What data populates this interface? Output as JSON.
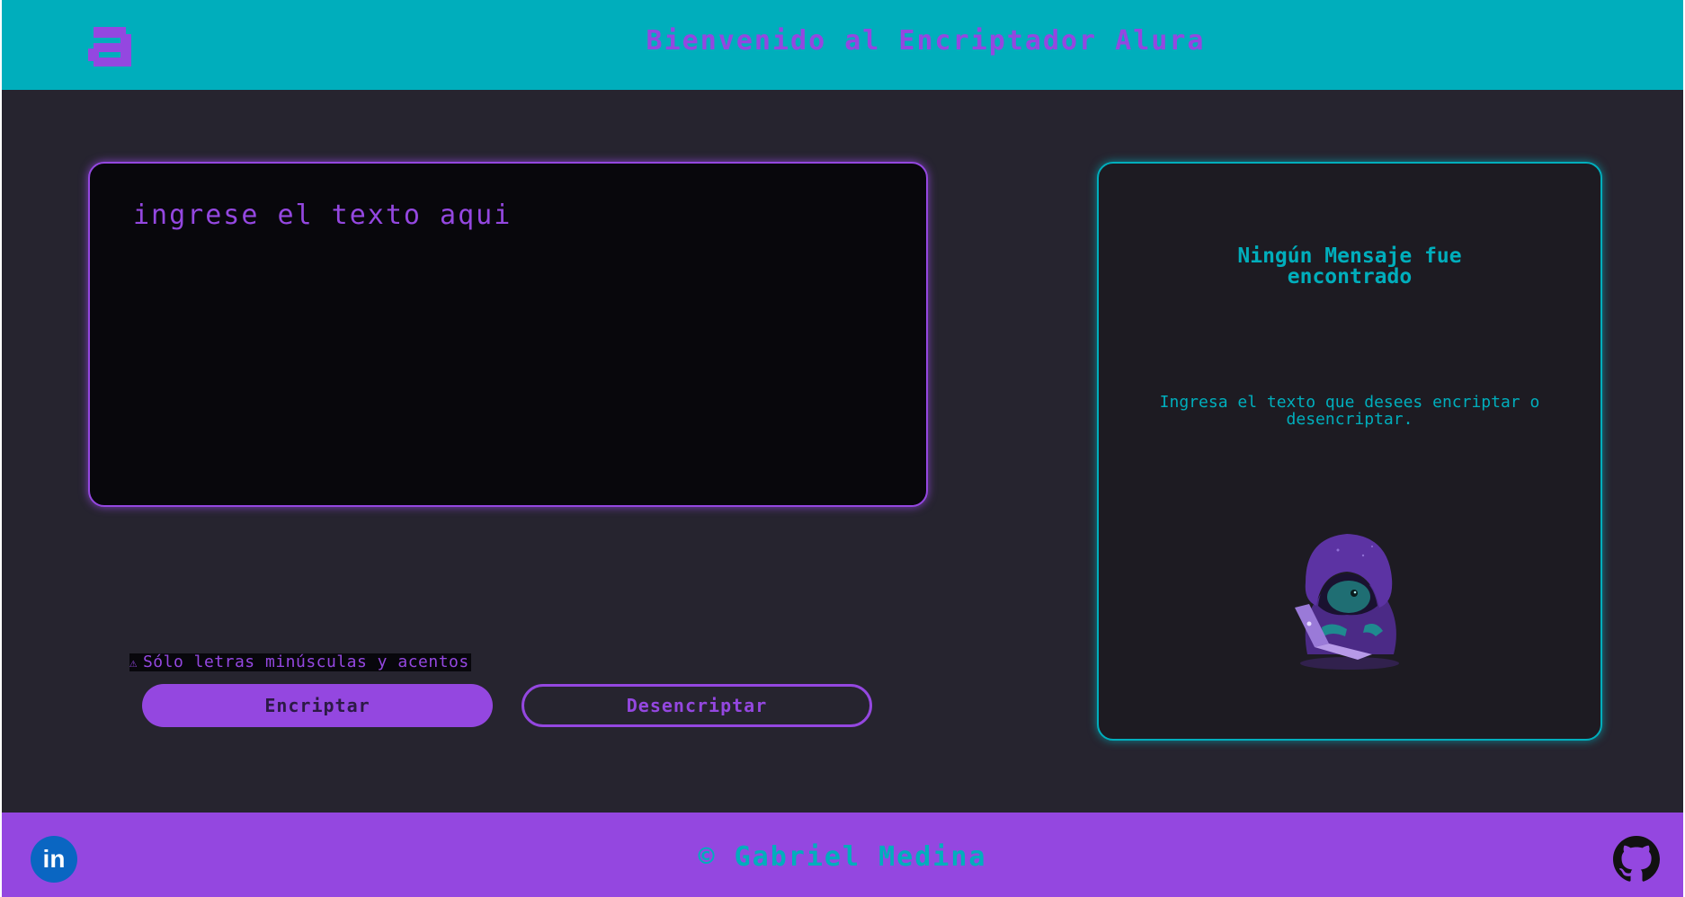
{
  "header": {
    "title": "Bienvenido al Encriptador Alura",
    "logo_icon": "alura-logo-icon"
  },
  "input": {
    "placeholder": "ingrese el texto aqui"
  },
  "warning": {
    "icon": "⚠",
    "text": "Sólo letras minúsculas y acentos"
  },
  "buttons": {
    "encrypt_label": "Encriptar",
    "decrypt_label": "Desencriptar"
  },
  "output": {
    "title": "Ningún Mensaje fue encontrado",
    "text": "Ingresa el texto que desees encriptar o desencriptar.",
    "illustration": "hooded-hacker-creature-illustration"
  },
  "footer": {
    "copyright": "© Gabriel Medina",
    "linkedin_label": "in",
    "linkedin_icon": "linkedin-icon",
    "github_icon": "github-icon"
  },
  "colors": {
    "header_bg": "#00aebc",
    "accent_purple": "#9447e0",
    "page_bg": "#26242f",
    "input_bg": "#08070c",
    "output_bg": "#1d1b22"
  }
}
